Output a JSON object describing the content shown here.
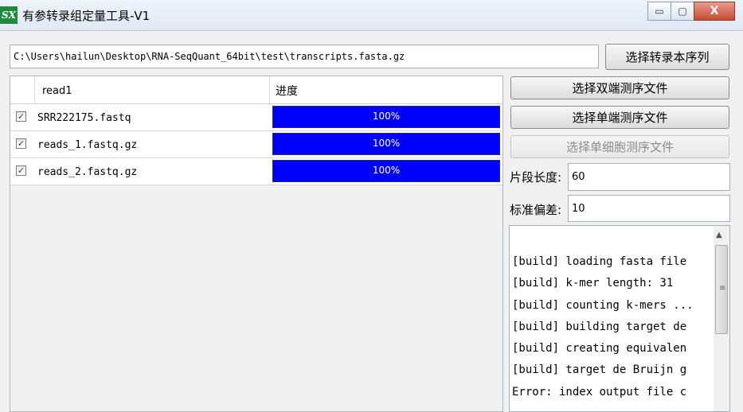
{
  "window": {
    "app_icon": "SX",
    "title": "有参转录组定量工具-V1",
    "minimize_glyph": "▭",
    "maximize_glyph": "▢",
    "close_glyph": "X"
  },
  "path": {
    "value": "C:\\Users\\hailun\\Desktop\\RNA-SeqQuant_64bit\\test\\transcripts.fasta.gz"
  },
  "buttons": {
    "select_transcript": "选择转录本序列",
    "select_paired": "选择双端测序文件",
    "select_single": "选择单端测序文件",
    "select_single_cell": "选择单细胞测序文件"
  },
  "table": {
    "columns": [
      "read1",
      "进度"
    ],
    "rows": [
      {
        "checked": "✓",
        "file": "SRR222175.fastq",
        "progress": 100,
        "progress_text": "100%"
      },
      {
        "checked": "✓",
        "file": "reads_1.fastq.gz",
        "progress": 100,
        "progress_text": "100%"
      },
      {
        "checked": "✓",
        "file": "reads_2.fastq.gz",
        "progress": 100,
        "progress_text": "100%"
      }
    ]
  },
  "params": {
    "fragment_length_label": "片段长度:",
    "fragment_length_value": "60",
    "std_dev_label": "标准偏差:",
    "std_dev_value": "10"
  },
  "log": {
    "lines": [
      "[build] loading fasta file",
      "[build] k-mer length: 31",
      "[build] counting k-mers ...",
      "[build] building target de",
      "[build] creating equivalen",
      "[build] target de Bruijn g",
      "Error: index output file c"
    ],
    "scroll_up_glyph": "▲",
    "scroll_grip_glyph": "≡"
  },
  "colors": {
    "progress_fill": "#0000ff",
    "app_icon_bg": "#1f8a3e",
    "close_button": "#c84b33"
  }
}
